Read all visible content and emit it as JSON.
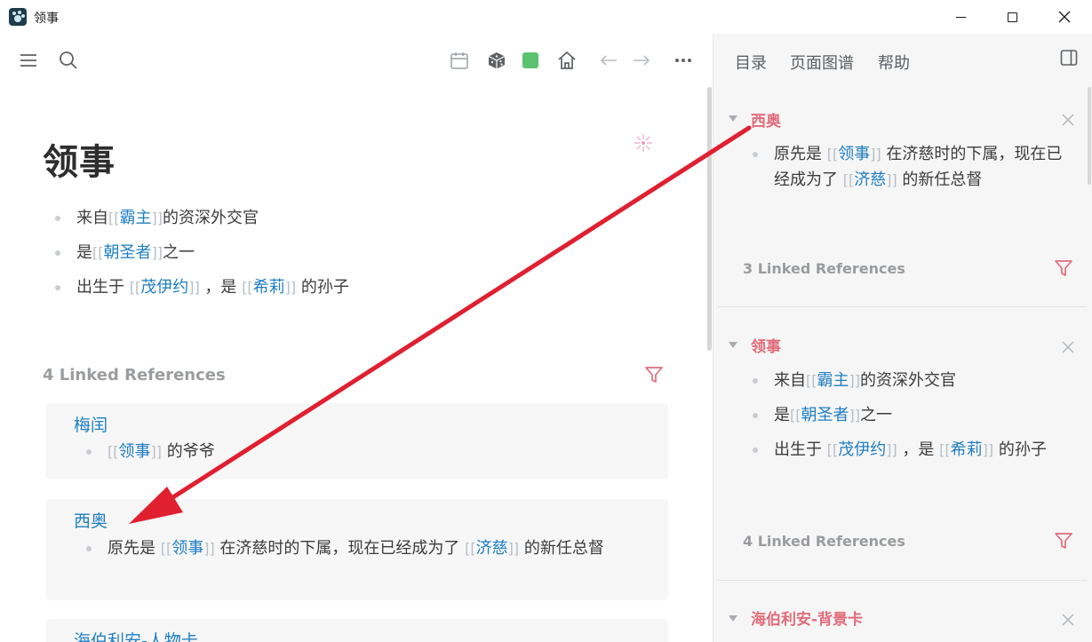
{
  "window": {
    "title": "领事"
  },
  "toolbar": {
    "icons": [
      "menu-icon",
      "search-icon",
      "calendar-icon",
      "dice-icon",
      "status-square-icon",
      "home-icon",
      "back-arrow-icon",
      "forward-arrow-icon",
      "more-icon"
    ],
    "status_color": "#5bc26f"
  },
  "page": {
    "title": "领事",
    "blocks": [
      {
        "pre": "来自",
        "link": "霸主",
        "post": "的资深外交官"
      },
      {
        "pre": "是",
        "link": "朝圣者",
        "post": "之一"
      },
      {
        "pre": "出生于 ",
        "link1": "茂伊约",
        "mid": " ，是 ",
        "link2": "希莉",
        "post": " 的孙子"
      }
    ],
    "linked_refs_title": "4 Linked References",
    "refs": [
      {
        "title": "梅闰",
        "pre": "",
        "link": "领事",
        "post": " 的爷爷"
      },
      {
        "title": "西奥",
        "pre": "原先是 ",
        "link": "领事",
        "mid": " 在济慈时的下属，现在已经成为了 ",
        "link2": "济慈",
        "post": " 的新任总督"
      },
      {
        "title": "海伯利安-人物卡"
      }
    ]
  },
  "sidebar": {
    "tabs": [
      "目录",
      "页面图谱",
      "帮助"
    ],
    "sections": [
      {
        "title": "西奥",
        "bullet": {
          "pre": "原先是 ",
          "link": "领事",
          "mid": " 在济慈时的下属，现在已经成为了 ",
          "link2": "济慈",
          "post": " 的新任总督"
        },
        "linked_refs_title": "3 Linked References"
      },
      {
        "title": "领事",
        "bullets": [
          {
            "pre": "来自",
            "link": "霸主",
            "post": "的资深外交官"
          },
          {
            "pre": "是",
            "link": "朝圣者",
            "post": "之一"
          },
          {
            "pre": "出生于 ",
            "link1": "茂伊约",
            "mid": " ，是 ",
            "link2": "希莉",
            "post": " 的孙子"
          }
        ],
        "linked_refs_title": "4 Linked References"
      },
      {
        "title": "海伯利安-背景卡"
      }
    ]
  },
  "colors": {
    "link": "#1f7ec2",
    "sidebar_title": "#e06c7a",
    "filter": "#e06c7a",
    "annotation_arrow": "#e02030"
  }
}
